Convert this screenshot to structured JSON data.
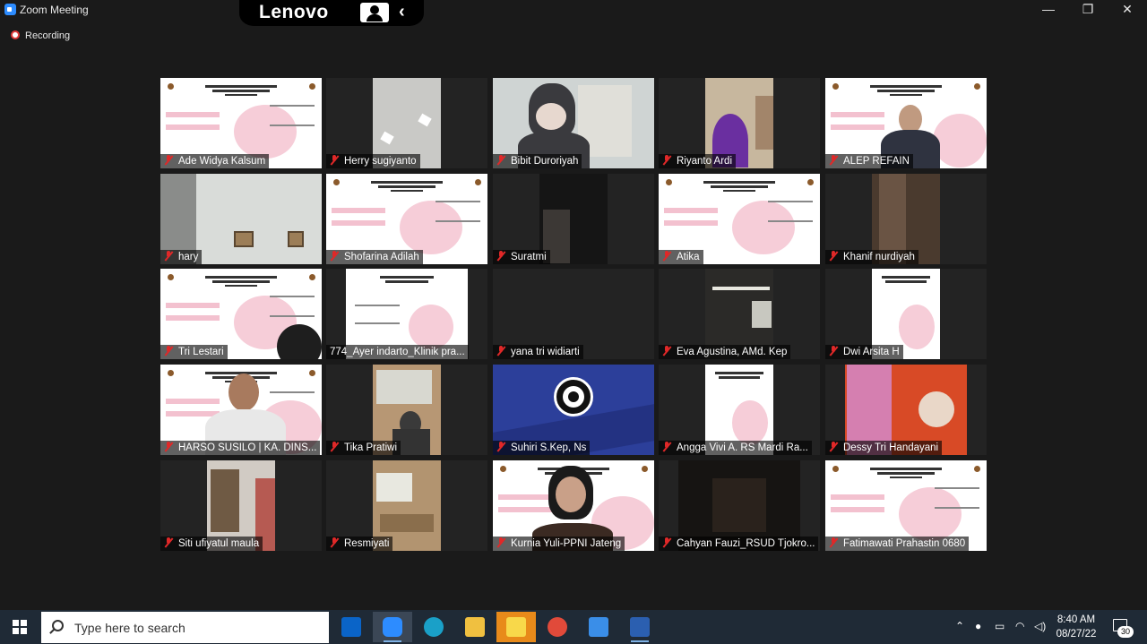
{
  "window": {
    "title": "Zoom Meeting",
    "minimize": "—",
    "maximize": "❐",
    "close": "✕"
  },
  "overlay": {
    "brand": "Lenovo"
  },
  "recording": {
    "label": "Recording"
  },
  "participants": [
    {
      "name": "Ade Widya Kalsum",
      "muted": true
    },
    {
      "name": "Herry sugiyanto",
      "muted": true
    },
    {
      "name": "Bibit Duroriyah",
      "muted": true
    },
    {
      "name": "Riyanto Ardi",
      "muted": true
    },
    {
      "name": "ALEP REFAIN",
      "muted": true
    },
    {
      "name": "hary",
      "muted": true
    },
    {
      "name": "Shofarina Adilah",
      "muted": true
    },
    {
      "name": "Suratmi",
      "muted": true
    },
    {
      "name": "Atika",
      "muted": true
    },
    {
      "name": "Khanif nurdiyah",
      "muted": true
    },
    {
      "name": "Tri Lestari",
      "muted": true
    },
    {
      "name": "774_Ayer indarto_Klinik pra...",
      "muted": false
    },
    {
      "name": "yana tri widiarti",
      "muted": true
    },
    {
      "name": "Eva Agustina, AMd. Kep",
      "muted": true
    },
    {
      "name": "Dwi Arsita H",
      "muted": true
    },
    {
      "name": "HARSO SUSILO | KA. DINS...",
      "muted": true
    },
    {
      "name": "Tika Pratiwi",
      "muted": true
    },
    {
      "name": "Suhiri S.Kep, Ns",
      "muted": true
    },
    {
      "name": "Angga Vivi A. RS Mardi Ra...",
      "muted": true
    },
    {
      "name": "Dessy Tri Handayani",
      "muted": true
    },
    {
      "name": "Siti ufiyatul maula",
      "muted": true
    },
    {
      "name": "Resmiyati",
      "muted": true
    },
    {
      "name": "Kurnia Yuli-PPNI Jateng",
      "muted": true
    },
    {
      "name": "Cahyan Fauzi_RSUD Tjokro...",
      "muted": true
    },
    {
      "name": "Fatimawati Prahastin 0680",
      "muted": true
    }
  ],
  "taskbar": {
    "search_placeholder": "Type here to search",
    "apps": [
      "outlook-icon",
      "zoom-icon",
      "edge-icon",
      "file-explorer-icon",
      "sticky-notes-icon",
      "chrome-icon",
      "photos-icon",
      "word-icon"
    ],
    "time": "8:40 AM",
    "date": "08/27/22",
    "notification_count": "30"
  }
}
